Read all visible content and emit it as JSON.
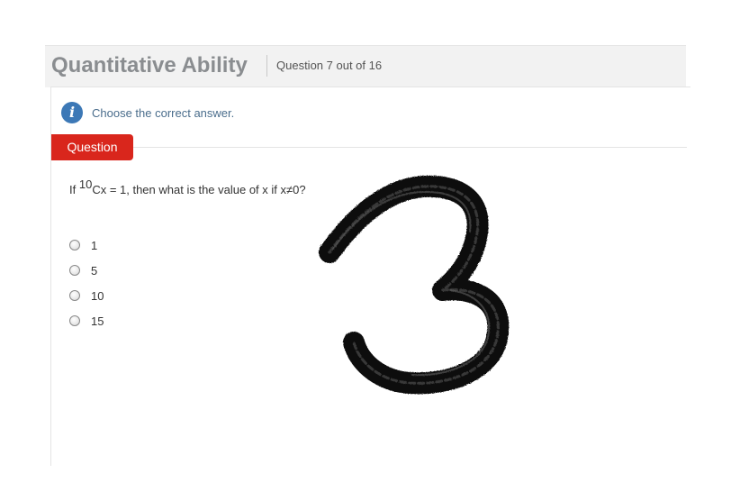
{
  "header": {
    "title": "Quantitative Ability",
    "question_counter": "Question 7 out of 16"
  },
  "instruction": {
    "icon": "info-icon",
    "text": "Choose the correct answer."
  },
  "tab": {
    "label": "Question"
  },
  "question": {
    "prefix": "If ",
    "superscript": "10",
    "text": "Cx = 1, then what is the value of x if x≠0?"
  },
  "options": [
    {
      "label": "1"
    },
    {
      "label": "5"
    },
    {
      "label": "10"
    },
    {
      "label": "15"
    }
  ],
  "overlay": {
    "handwritten_digit": "3"
  },
  "colors": {
    "accent_red": "#d9261c",
    "info_blue": "#3c78b6",
    "title_gray": "#8a8d90"
  }
}
